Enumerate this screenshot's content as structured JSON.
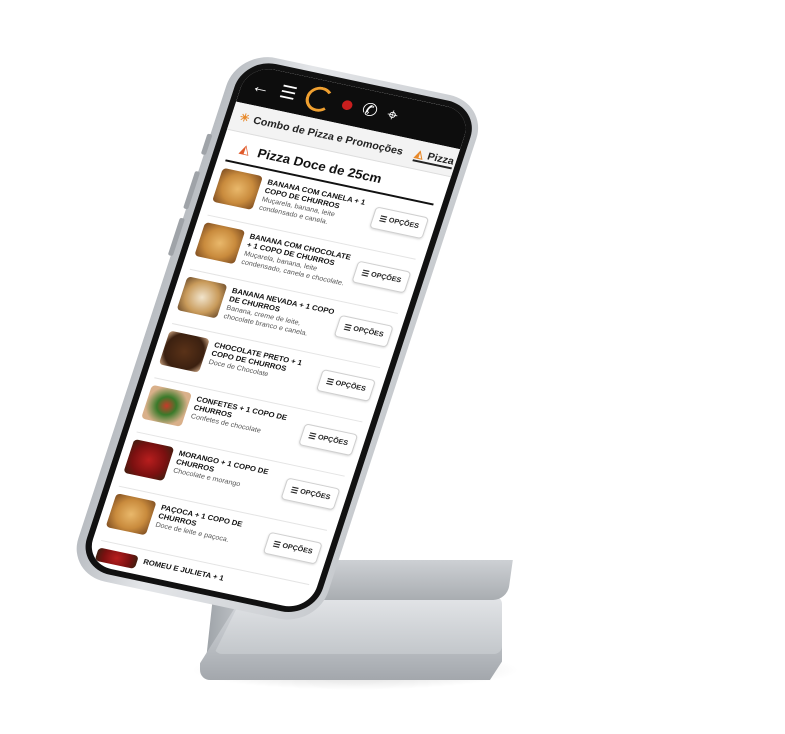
{
  "topbar": {
    "back_icon": "back-arrow-icon",
    "menu_icon": "hamburger-menu-icon",
    "whatsapp_icon": "whatsapp-icon",
    "map_icon": "map-icon"
  },
  "tabs": [
    {
      "label": "Combo de Pizza e Promoções",
      "icon": "sun-icon"
    },
    {
      "label": "Pizza",
      "icon": "pizza-icon"
    }
  ],
  "section": {
    "title": "Pizza Doce de 25cm",
    "icon": "pizza-slice-icon"
  },
  "option_label": "OPÇÕES",
  "items": [
    {
      "name": "BANANA COM CANELA + 1 COPO DE CHURROS",
      "desc": "Muçarela, banana, leite condensado e canela."
    },
    {
      "name": "BANANA COM CHOCOLATE + 1 COPO DE CHURROS",
      "desc": "Muçarela, banana, leite condensado, canela e chocolate."
    },
    {
      "name": "BANANA NEVADA + 1 COPO DE CHURROS",
      "desc": "Banana, creme de leite, chocolate branco e canela."
    },
    {
      "name": "CHOCOLATE PRETO + 1 COPO DE CHURROS",
      "desc": "Doce de Chocolate"
    },
    {
      "name": "CONFETES + 1 COPO DE CHURROS",
      "desc": "Confetes de chocolate"
    },
    {
      "name": "MORANGO + 1 COPO DE CHURROS",
      "desc": "Chocolate e morango"
    },
    {
      "name": "PAÇOCA + 1 COPO DE CHURROS",
      "desc": "Doce de leite e paçoca."
    },
    {
      "name": "ROMEU E JULIETA + 1",
      "desc": ""
    }
  ]
}
